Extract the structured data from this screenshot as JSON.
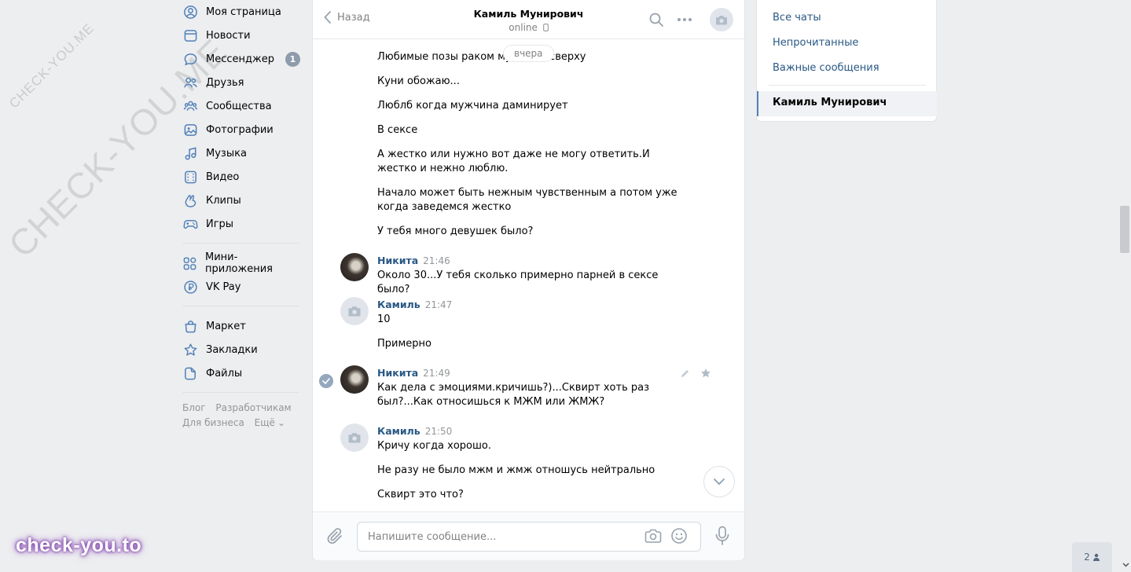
{
  "watermark": {
    "small": "CHECK-YOU.ME",
    "big": "CHECK-YOU.ME",
    "logo": "check-you.to"
  },
  "nav": {
    "items": [
      {
        "label": "Моя страница",
        "icon": "user-circle-icon"
      },
      {
        "label": "Новости",
        "icon": "news-icon"
      },
      {
        "label": "Мессенджер",
        "icon": "message-icon",
        "badge": "1"
      },
      {
        "label": "Друзья",
        "icon": "friends-icon"
      },
      {
        "label": "Сообщества",
        "icon": "communities-icon"
      },
      {
        "label": "Фотографии",
        "icon": "photo-icon"
      },
      {
        "label": "Музыка",
        "icon": "music-icon"
      },
      {
        "label": "Видео",
        "icon": "video-icon"
      },
      {
        "label": "Клипы",
        "icon": "clips-icon"
      },
      {
        "label": "Игры",
        "icon": "gamepad-icon"
      }
    ],
    "items2": [
      {
        "label": "Мини-приложения",
        "icon": "apps-icon"
      },
      {
        "label": "VK Pay",
        "icon": "vkpay-icon"
      }
    ],
    "items3": [
      {
        "label": "Маркет",
        "icon": "market-icon"
      },
      {
        "label": "Закладки",
        "icon": "bookmark-star-icon"
      },
      {
        "label": "Файлы",
        "icon": "file-icon"
      }
    ],
    "footer": {
      "blog": "Блог",
      "dev": "Разработчикам",
      "business": "Для бизнеса",
      "more": "Ещё"
    }
  },
  "chat": {
    "back": "Назад",
    "title": "Камиль Мунирович",
    "status": "online",
    "date_pill": "вчера",
    "messages": {
      "m1": "Любимые позы раком мужчина сверху",
      "m2": "Куни обожаю...",
      "m3": "Люблб когда мужчина даминирует",
      "m4": "В сексе",
      "m5": "А жестко или нужно вот даже не могу ответить.И жестко и нежно люблю.",
      "m6": "Начало может быть нежным чувственным а потом уже когда заведемся жестко",
      "m7": "У тебя много девушек было?",
      "g1_author": "Никита",
      "g1_time": "21:46",
      "g1_text": "Около 30...У тебя сколько примерно парней в сексе было?",
      "g2_author": "Камиль",
      "g2_time": "21:47",
      "g2_text1": "10",
      "g2_text2": "Примерно",
      "g3_author": "Никита",
      "g3_time": "21:49",
      "g3_text": "Как дела с эмоциями.кричишь?)...Сквирт хоть раз был?...Как относишься к МЖМ или ЖМЖ?",
      "g4_author": "Камиль",
      "g4_time": "21:50",
      "g4_text1": "Кричу когда хорошо.",
      "g4_text2": "Не разу не было мжм и жмж отношусь нейтрально",
      "g4_text3": "Сквирт это что?"
    },
    "composer_placeholder": "Напишите сообщение..."
  },
  "right_panel": {
    "all": "Все чаты",
    "unread": "Непрочитанные",
    "important": "Важные сообщения",
    "active": "Камиль Мунирович"
  },
  "online_count": "2"
}
